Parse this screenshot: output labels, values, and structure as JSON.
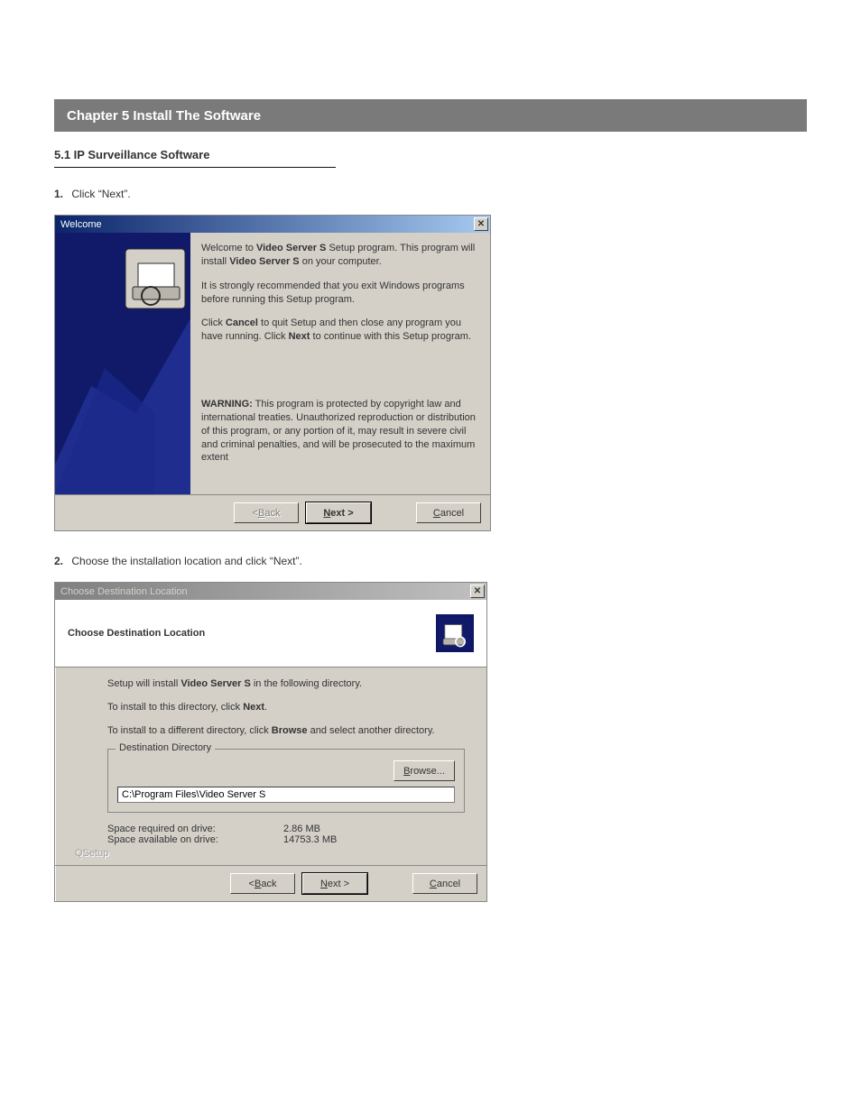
{
  "doc": {
    "heading_bar": "Chapter 5    Install The Software",
    "section_title": "5.1 IP Surveillance Software",
    "step1_label": "1.",
    "step1_text": "Click “Next”.",
    "step2_label": "2.",
    "step2_text": "Choose the installation location and click “Next”.",
    "qsetup": "QSetup"
  },
  "dialog1": {
    "title": "Welcome",
    "close_glyph": "✕",
    "para1_pre": "Welcome to ",
    "para1_b1": "Video Server S",
    "para1_mid": " Setup program. This program will install ",
    "para1_b2": "Video Server S",
    "para1_end": " on your computer.",
    "para2": "It is strongly recommended that you exit Windows programs before running this Setup program.",
    "para3_pre": "Click ",
    "para3_b1": "Cancel",
    "para3_mid": " to quit Setup and then close any program you have running. Click ",
    "para3_b2": "Next",
    "para3_end": " to continue with this Setup program.",
    "warn_b": "WARNING:",
    "warn_rest": " This program is protected by copyright law and international treaties. Unauthorized reproduction or distribution of this program, or any portion of it, may result in severe civil and criminal penalties, and will be prosecuted to the maximum extent",
    "back_prefix": "< ",
    "back_u": "B",
    "back_rest": "ack",
    "next_u": "N",
    "next_rest": "ext >",
    "cancel_u": "C",
    "cancel_rest": "ancel"
  },
  "dialog2": {
    "title": "Choose Destination Location",
    "header": "Choose Destination Location",
    "p1_pre": "Setup will install ",
    "p1_b": "Video Server S",
    "p1_end": " in the following directory.",
    "p2_pre": "To install to this directory, click ",
    "p2_b": "Next",
    "p2_end": ".",
    "p3_pre": "To install to a different directory, click ",
    "p3_b": "Browse",
    "p3_end": " and select another directory.",
    "group_label": "Destination Directory",
    "browse_u": "B",
    "browse_rest": "rowse...",
    "path_value": "C:\\Program Files\\Video Server S",
    "space_required_label": "Space required on drive:",
    "space_required_value": "2.86 MB",
    "space_available_label": "Space available on drive:",
    "space_available_value": "14753.3 MB",
    "back_prefix": "< ",
    "back_u": "B",
    "back_rest": "ack",
    "next_u": "N",
    "next_rest": "ext >",
    "cancel_u": "C",
    "cancel_rest": "ancel"
  }
}
